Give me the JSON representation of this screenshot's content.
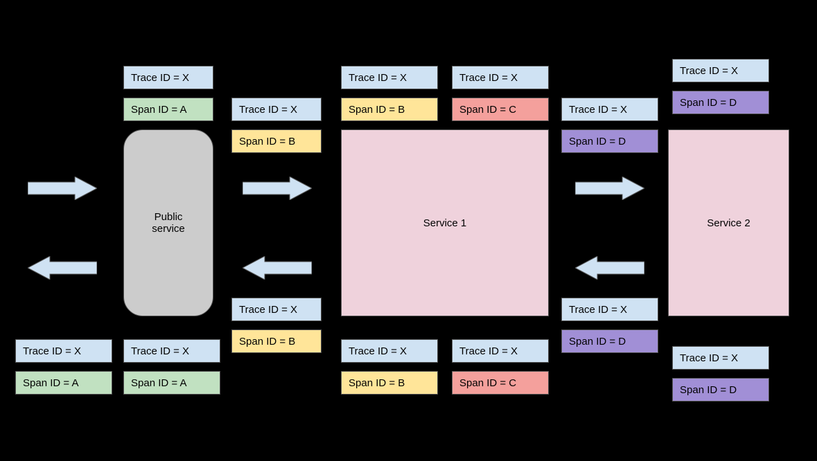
{
  "nodes": {
    "public_service": "Public\nservice",
    "service1": "Service 1",
    "service2": "Service 2"
  },
  "labels": {
    "trace_x": "Trace ID = X",
    "span_a": "Span ID = A",
    "span_b": "Span ID = B",
    "span_c": "Span ID = C",
    "span_d": "Span ID = D"
  }
}
